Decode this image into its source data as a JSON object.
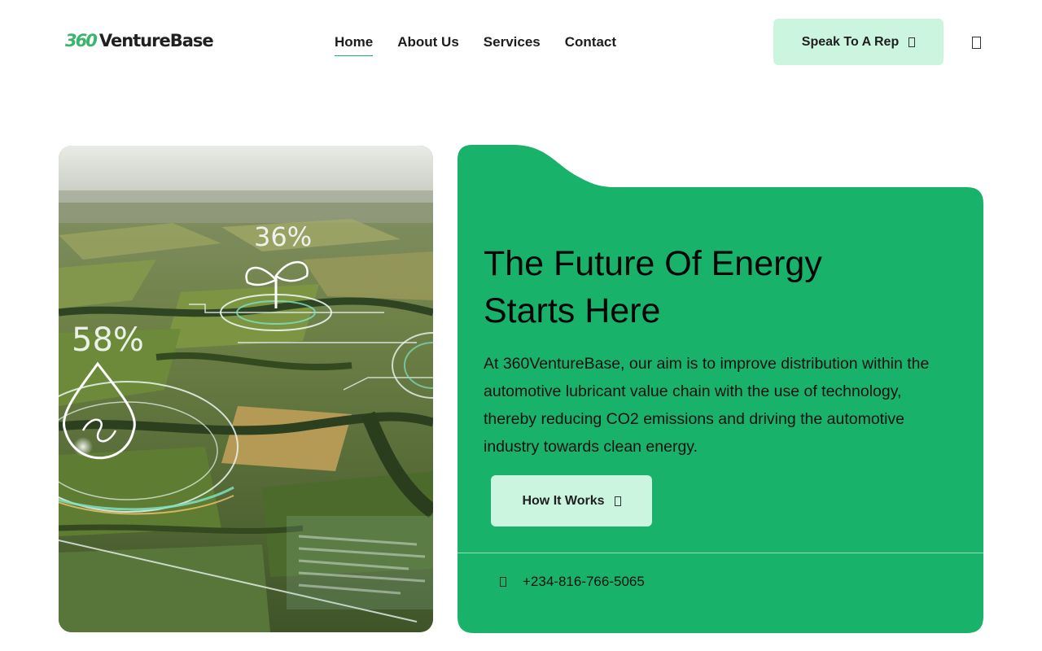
{
  "brand": {
    "logo_number": "360",
    "logo_name": "VentureBase",
    "accent_color": "#19b26b",
    "light_accent_color": "#ccf5e0"
  },
  "nav": {
    "items": [
      {
        "label": "Home",
        "active": true
      },
      {
        "label": "About Us",
        "active": false
      },
      {
        "label": "Services",
        "active": false
      },
      {
        "label": "Contact",
        "active": false
      }
    ]
  },
  "header": {
    "cta_label": "Speak To A Rep",
    "cta_icon": "arrow-icon",
    "menu_icon": "menu-icon"
  },
  "hero_image": {
    "overlay_labels": [
      "36%",
      "58%"
    ]
  },
  "hero": {
    "title_line1": "The Future Of Energy",
    "title_line2": "Starts Here",
    "description": "At 360VentureBase, our aim is to improve distribution within the automotive lubricant value chain with the use of technology, thereby reducing CO2 emissions and driving the automotive industry towards clean energy.",
    "button_label": "How It Works",
    "phone": "+234-816-766-5065"
  }
}
